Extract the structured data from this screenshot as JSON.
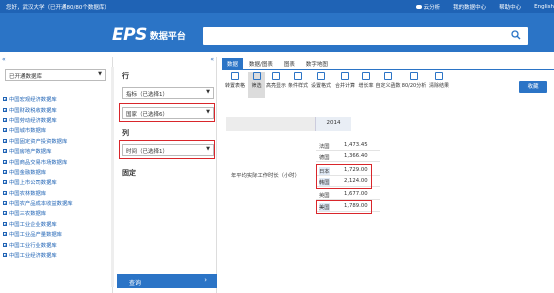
{
  "topbar": {
    "greeting": "您好，武汉大学（已开通80/80个数据库）",
    "links": [
      "云分析",
      "我的数据中心",
      "帮助中心",
      "English"
    ]
  },
  "header": {
    "logo_text": "EPS",
    "platform_name": "数据平台",
    "search_placeholder": ""
  },
  "sidebar": {
    "collapse_glyph": "«",
    "selector": "已开通数据库",
    "databases": [
      "中国宏观经济数据库",
      "中国财政税收数据库",
      "中国劳动经济数据库",
      "中国城市数据库",
      "中国固定资产投资数据库",
      "中国房地产数据库",
      "中国商品交易市场数据库",
      "中国金融数据库",
      "中国上市公司数据库",
      "中国农林数据库",
      "中国农产品成本收益数据库",
      "中国三农数据库",
      "中国工业企业数据库",
      "中国工业品产量数据库",
      "中国工业行业数据库",
      "中国工业经济数据库"
    ]
  },
  "panel": {
    "collapse_glyph": "«",
    "row_title": "行",
    "row_selects": [
      "指标（已选择1）",
      "国家（已选择6）"
    ],
    "col_title": "列",
    "col_selects": [
      "时间（已选择1）"
    ],
    "fixed_title": "固定",
    "query_label": "查询",
    "query_arrow": "›"
  },
  "tabs": [
    "数据",
    "数据/图表",
    "图表",
    "数字地图"
  ],
  "toolbar": [
    "转置表格",
    "筛选",
    "高亮显示",
    "条件样式",
    "设置格式",
    "合并计算",
    "增长率",
    "自定义函数",
    "80/20分析",
    "清除结果"
  ],
  "collect_label": "收藏",
  "table": {
    "year": "2014",
    "indicator": "年平均实际工作时长（小时）",
    "rows": [
      {
        "country": "法国",
        "value": "1,473.45"
      },
      {
        "country": "德国",
        "value": "1,366.40"
      },
      {
        "country": "日本",
        "value": "1,729.00"
      },
      {
        "country": "韩国",
        "value": "2,124.00"
      },
      {
        "country": "英国",
        "value": "1,677.00"
      },
      {
        "country": "美国",
        "value": "1,789.00"
      }
    ]
  },
  "colors": {
    "brand_blue": "#2b74c6",
    "topbar_blue": "#1f63b5",
    "highlight_red": "#d9262b"
  }
}
